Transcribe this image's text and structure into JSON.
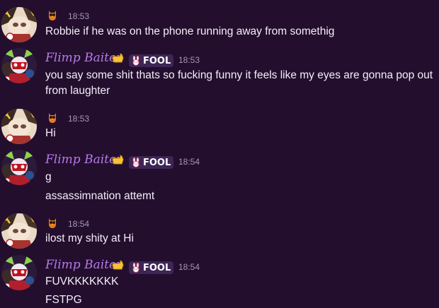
{
  "colors": {
    "background": "#230e2e",
    "author_name": "#b67be8",
    "badge_bg": "#3d2656",
    "timestamp": "#a698b3",
    "message_text": "#f4eef8"
  },
  "groups": [
    {
      "avatar": "avatar-owl-user",
      "timestamp": "18:53",
      "messages": [
        "Robbie if he was on the phone running away from somethig"
      ]
    },
    {
      "avatar": "avatar-flimp-baiter",
      "author": "Flimp Baiter",
      "badge": "FOOL",
      "timestamp": "18:53",
      "messages": [
        "you say some shit thats so fucking funny it feels like my eyes are gonna pop out from laughter"
      ]
    },
    {
      "avatar": "avatar-owl-user",
      "timestamp": "18:53",
      "messages": [
        "Hi"
      ]
    },
    {
      "avatar": "avatar-flimp-baiter",
      "author": "Flimp Baiter",
      "badge": "FOOL",
      "timestamp": "18:54",
      "messages": [
        "g",
        "assassimnation attemt"
      ]
    },
    {
      "avatar": "avatar-owl-user",
      "timestamp": "18:54",
      "messages": [
        "ilost my shity at Hi"
      ]
    },
    {
      "avatar": "avatar-flimp-baiter",
      "author": "Flimp Baiter",
      "badge": "FOOL",
      "timestamp": "18:54",
      "messages": [
        "FUVKKKKKKK",
        "FSTPG"
      ]
    }
  ]
}
